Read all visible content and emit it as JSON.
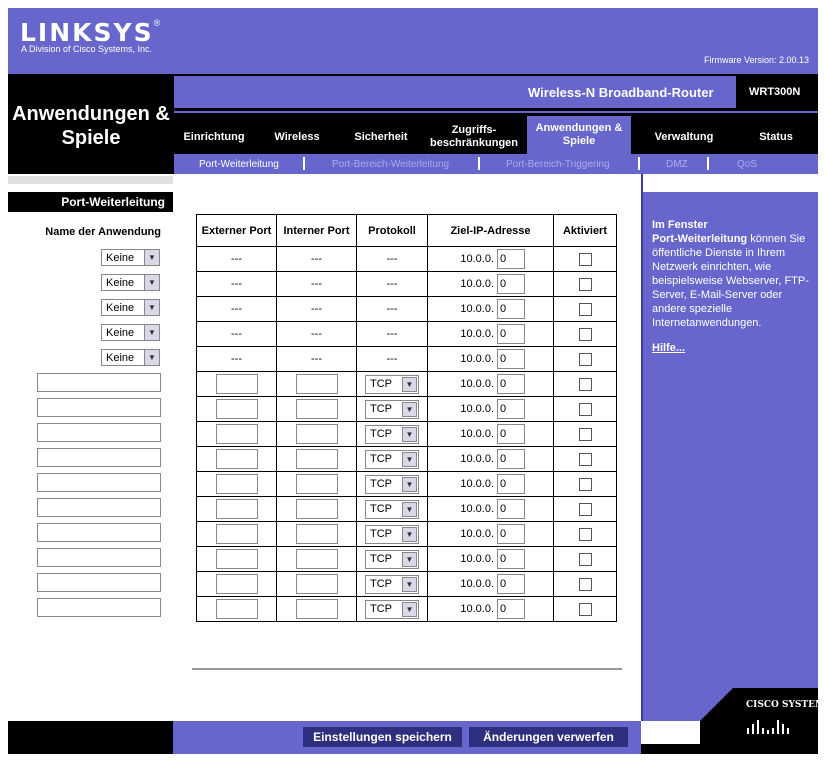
{
  "brand": {
    "logo": "LINKSYS",
    "registered": "®",
    "tagline": "A Division of Cisco Systems, Inc."
  },
  "firmware": "Firmware Version: 2.00.13",
  "product_name": "Wireless-N Broadband-Router",
  "model": "WRT300N",
  "section_title_line1": "Anwendungen &",
  "section_title_line2": "Spiele",
  "tabs": [
    {
      "label_line1": "Einrichtung",
      "label_line2": ""
    },
    {
      "label_line1": "Wireless",
      "label_line2": ""
    },
    {
      "label_line1": "Sicherheit",
      "label_line2": ""
    },
    {
      "label_line1": "Zugriffs-",
      "label_line2": "beschränkungen"
    },
    {
      "label_line1": "Anwendungen &",
      "label_line2": "Spiele"
    },
    {
      "label_line1": "Verwaltung",
      "label_line2": ""
    },
    {
      "label_line1": "Status",
      "label_line2": ""
    }
  ],
  "subtabs": [
    "Port-Weiterleitung",
    "Port-Bereich-Weiterleitung",
    "Port-Bereich-Triggering",
    "DMZ",
    "QoS"
  ],
  "left": {
    "title": "Port-Weiterleitung",
    "column_label": "Name der Anwendung",
    "select_value": "Keine"
  },
  "table": {
    "headers": [
      "Externer Port",
      "Interner Port",
      "Protokoll",
      "Ziel-IP-Adresse",
      "Aktiviert"
    ],
    "placeholder": "---",
    "ip_prefix": "10.0.0.",
    "ip_last": "0",
    "protocol_value": "TCP"
  },
  "help": {
    "line1": "Im Fenster",
    "bold2": "Port-Weiterleitung",
    "rest": " können Sie öffentliche Dienste in Ihrem Netzwerk einrichten, wie beispielsweise Webserver, FTP-Server, E-Mail-Server oder andere spezielle Internetanwendungen.",
    "link": "Hilfe..."
  },
  "cisco": {
    "name": "Cisco Systems"
  },
  "buttons": {
    "save": "Einstellungen speichern",
    "cancel": "Änderungen verwerfen"
  },
  "colors": {
    "purple": "#6666cc",
    "dark_purple": "#3d3d99",
    "black": "#000000"
  }
}
